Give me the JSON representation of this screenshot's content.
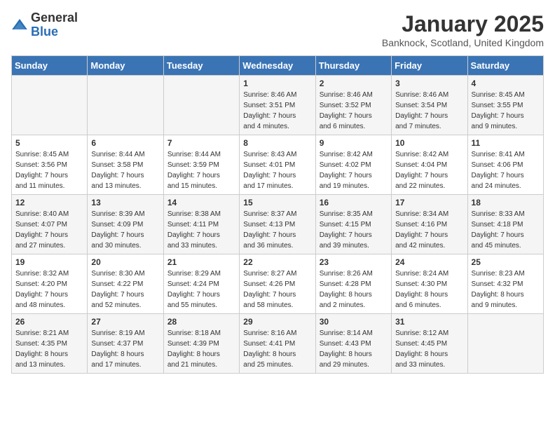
{
  "logo": {
    "general": "General",
    "blue": "Blue"
  },
  "title": "January 2025",
  "location": "Banknock, Scotland, United Kingdom",
  "days_of_week": [
    "Sunday",
    "Monday",
    "Tuesday",
    "Wednesday",
    "Thursday",
    "Friday",
    "Saturday"
  ],
  "weeks": [
    [
      {
        "day": "",
        "info": ""
      },
      {
        "day": "",
        "info": ""
      },
      {
        "day": "",
        "info": ""
      },
      {
        "day": "1",
        "info": "Sunrise: 8:46 AM\nSunset: 3:51 PM\nDaylight: 7 hours\nand 4 minutes."
      },
      {
        "day": "2",
        "info": "Sunrise: 8:46 AM\nSunset: 3:52 PM\nDaylight: 7 hours\nand 6 minutes."
      },
      {
        "day": "3",
        "info": "Sunrise: 8:46 AM\nSunset: 3:54 PM\nDaylight: 7 hours\nand 7 minutes."
      },
      {
        "day": "4",
        "info": "Sunrise: 8:45 AM\nSunset: 3:55 PM\nDaylight: 7 hours\nand 9 minutes."
      }
    ],
    [
      {
        "day": "5",
        "info": "Sunrise: 8:45 AM\nSunset: 3:56 PM\nDaylight: 7 hours\nand 11 minutes."
      },
      {
        "day": "6",
        "info": "Sunrise: 8:44 AM\nSunset: 3:58 PM\nDaylight: 7 hours\nand 13 minutes."
      },
      {
        "day": "7",
        "info": "Sunrise: 8:44 AM\nSunset: 3:59 PM\nDaylight: 7 hours\nand 15 minutes."
      },
      {
        "day": "8",
        "info": "Sunrise: 8:43 AM\nSunset: 4:01 PM\nDaylight: 7 hours\nand 17 minutes."
      },
      {
        "day": "9",
        "info": "Sunrise: 8:42 AM\nSunset: 4:02 PM\nDaylight: 7 hours\nand 19 minutes."
      },
      {
        "day": "10",
        "info": "Sunrise: 8:42 AM\nSunset: 4:04 PM\nDaylight: 7 hours\nand 22 minutes."
      },
      {
        "day": "11",
        "info": "Sunrise: 8:41 AM\nSunset: 4:06 PM\nDaylight: 7 hours\nand 24 minutes."
      }
    ],
    [
      {
        "day": "12",
        "info": "Sunrise: 8:40 AM\nSunset: 4:07 PM\nDaylight: 7 hours\nand 27 minutes."
      },
      {
        "day": "13",
        "info": "Sunrise: 8:39 AM\nSunset: 4:09 PM\nDaylight: 7 hours\nand 30 minutes."
      },
      {
        "day": "14",
        "info": "Sunrise: 8:38 AM\nSunset: 4:11 PM\nDaylight: 7 hours\nand 33 minutes."
      },
      {
        "day": "15",
        "info": "Sunrise: 8:37 AM\nSunset: 4:13 PM\nDaylight: 7 hours\nand 36 minutes."
      },
      {
        "day": "16",
        "info": "Sunrise: 8:35 AM\nSunset: 4:15 PM\nDaylight: 7 hours\nand 39 minutes."
      },
      {
        "day": "17",
        "info": "Sunrise: 8:34 AM\nSunset: 4:16 PM\nDaylight: 7 hours\nand 42 minutes."
      },
      {
        "day": "18",
        "info": "Sunrise: 8:33 AM\nSunset: 4:18 PM\nDaylight: 7 hours\nand 45 minutes."
      }
    ],
    [
      {
        "day": "19",
        "info": "Sunrise: 8:32 AM\nSunset: 4:20 PM\nDaylight: 7 hours\nand 48 minutes."
      },
      {
        "day": "20",
        "info": "Sunrise: 8:30 AM\nSunset: 4:22 PM\nDaylight: 7 hours\nand 52 minutes."
      },
      {
        "day": "21",
        "info": "Sunrise: 8:29 AM\nSunset: 4:24 PM\nDaylight: 7 hours\nand 55 minutes."
      },
      {
        "day": "22",
        "info": "Sunrise: 8:27 AM\nSunset: 4:26 PM\nDaylight: 7 hours\nand 58 minutes."
      },
      {
        "day": "23",
        "info": "Sunrise: 8:26 AM\nSunset: 4:28 PM\nDaylight: 8 hours\nand 2 minutes."
      },
      {
        "day": "24",
        "info": "Sunrise: 8:24 AM\nSunset: 4:30 PM\nDaylight: 8 hours\nand 6 minutes."
      },
      {
        "day": "25",
        "info": "Sunrise: 8:23 AM\nSunset: 4:32 PM\nDaylight: 8 hours\nand 9 minutes."
      }
    ],
    [
      {
        "day": "26",
        "info": "Sunrise: 8:21 AM\nSunset: 4:35 PM\nDaylight: 8 hours\nand 13 minutes."
      },
      {
        "day": "27",
        "info": "Sunrise: 8:19 AM\nSunset: 4:37 PM\nDaylight: 8 hours\nand 17 minutes."
      },
      {
        "day": "28",
        "info": "Sunrise: 8:18 AM\nSunset: 4:39 PM\nDaylight: 8 hours\nand 21 minutes."
      },
      {
        "day": "29",
        "info": "Sunrise: 8:16 AM\nSunset: 4:41 PM\nDaylight: 8 hours\nand 25 minutes."
      },
      {
        "day": "30",
        "info": "Sunrise: 8:14 AM\nSunset: 4:43 PM\nDaylight: 8 hours\nand 29 minutes."
      },
      {
        "day": "31",
        "info": "Sunrise: 8:12 AM\nSunset: 4:45 PM\nDaylight: 8 hours\nand 33 minutes."
      },
      {
        "day": "",
        "info": ""
      }
    ]
  ]
}
